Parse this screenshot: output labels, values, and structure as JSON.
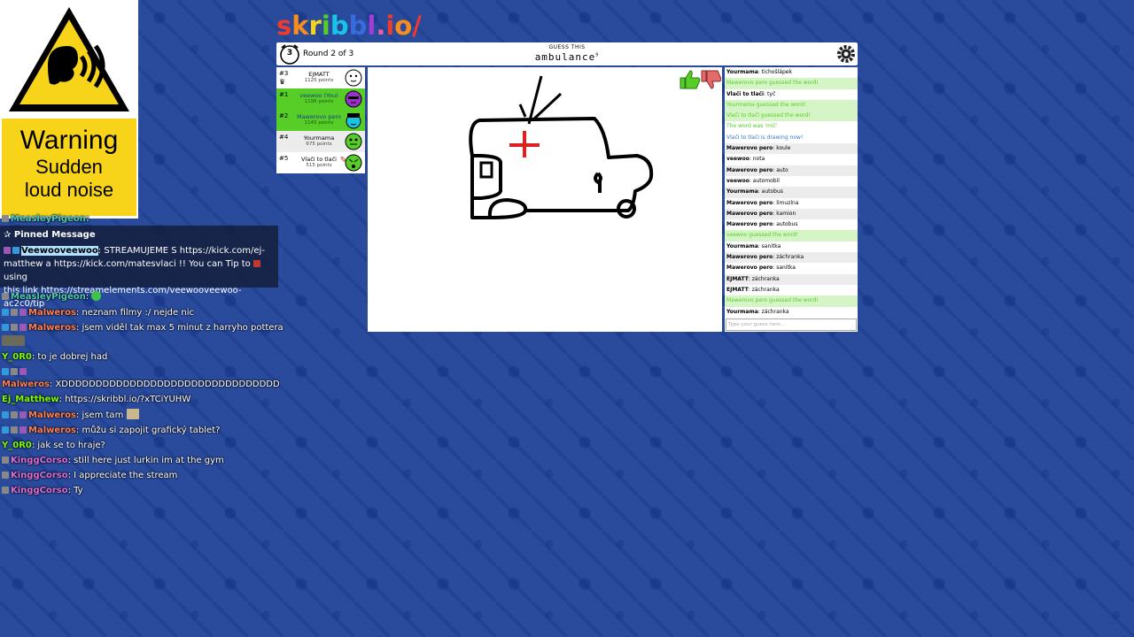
{
  "warning": {
    "title": "Warning",
    "line1": "Sudden",
    "line2": "loud noise"
  },
  "stream_chat": {
    "top_user": "MeasleyPigeon:",
    "pinned_title": "Pinned Message",
    "pinned_user": "Veewooveewoo",
    "pinned_text_1": ": STREAMUJEME S https://kick.com/ej-",
    "pinned_text_2": "matthew a https://kick.com/matesvlaci !! You can Tip to",
    "pinned_text_2b": "using",
    "pinned_text_3": "this link https://streamelements.com/veewooveewoo-ac2c0/tip",
    "messages": [
      {
        "user": "MeasleyPigeon",
        "text": ":",
        "color": "#4ec9b0"
      },
      {
        "user": "Malweros",
        "text": ": neznam filmy :/ nejde nic",
        "color": "#ff7f50"
      },
      {
        "user": "Malweros",
        "text": ": jsem viděl tak max 5 minut z harryho pottera",
        "color": "#ff7f50"
      },
      {
        "user": "Y_0R0",
        "text": ": to je dobrej had",
        "color": "#7cfc00"
      },
      {
        "user": "Malweros",
        "text": ": XDDDDDDDDDDDDDDDDDDDDDDDDDDDDDDDDDDDDD",
        "color": "#ff7f50"
      },
      {
        "user": "Ej_Matthew",
        "text": ": https://skribbl.io/?xTCiYUHW",
        "color": "#7cfc00"
      },
      {
        "user": "Malweros",
        "text": ": jsem tam",
        "color": "#ff7f50"
      },
      {
        "user": "Malweros",
        "text": ": můžu si zapojit grafický tablet?",
        "color": "#ff7f50"
      },
      {
        "user": "Y_0R0",
        "text": ": jak se to hraje?",
        "color": "#7cfc00"
      },
      {
        "user": "KinggCorso",
        "text": ": still here just lurkin im at the gym",
        "color": "#da70d6"
      },
      {
        "user": "KinggCorso",
        "text": ": I appreciate the stream",
        "color": "#da70d6"
      },
      {
        "user": "KinggCorso",
        "text": ": Ty",
        "color": "#da70d6"
      }
    ]
  },
  "game": {
    "logo": "skribbl.io",
    "round_number": "3",
    "round_text": "Round 2 of 3",
    "guess_label": "GUESS THIS",
    "word": "ambulance",
    "word_length": "9",
    "players": [
      {
        "rank": "#3",
        "name": "EJMATT",
        "points": "1125 points",
        "style": "white"
      },
      {
        "rank": "#1",
        "name": "veewoo (You)",
        "points": "1196 points",
        "style": "green"
      },
      {
        "rank": "#2",
        "name": "Mawerovo pero",
        "points": "1145 points",
        "style": "green"
      },
      {
        "rank": "#4",
        "name": "Yourmama",
        "points": "675 points",
        "style": "grey"
      },
      {
        "rank": "#5",
        "name": "Vlači to tlači",
        "points": "515 points",
        "style": "white"
      }
    ],
    "chat": [
      {
        "who": "Yourmama",
        "text": ": tichošlápek",
        "type": "normal"
      },
      {
        "who": "",
        "text": "Mawerovo pero guessed the word!",
        "type": "correct"
      },
      {
        "who": "Vlači to tlači",
        "text": ": tyč",
        "type": "normal"
      },
      {
        "who": "",
        "text": "Yourmama guessed the word!",
        "type": "correct"
      },
      {
        "who": "",
        "text": "Vlači to tlači guessed the word!",
        "type": "correct"
      },
      {
        "who": "",
        "text": "The word was 'míč'",
        "type": "correct"
      },
      {
        "who": "",
        "text": "Vlači to tlači is drawing now!",
        "type": "drawing"
      },
      {
        "who": "Mawerovo pero",
        "text": ": koule",
        "type": "alt"
      },
      {
        "who": "veewoo",
        "text": ": nota",
        "type": "normal"
      },
      {
        "who": "Mawerovo pero",
        "text": ": auto",
        "type": "alt"
      },
      {
        "who": "veewoo",
        "text": ": automobil",
        "type": "normal"
      },
      {
        "who": "Yourmama",
        "text": ": autobus",
        "type": "alt"
      },
      {
        "who": "Mawerovo pero",
        "text": ": limuzína",
        "type": "normal"
      },
      {
        "who": "Mawerovo pero",
        "text": ": kamion",
        "type": "alt"
      },
      {
        "who": "Mawerovo pero",
        "text": ": autobus",
        "type": "normal"
      },
      {
        "who": "",
        "text": "veewoo guessed the word!",
        "type": "correct"
      },
      {
        "who": "Yourmama",
        "text": ": sanitka",
        "type": "normal"
      },
      {
        "who": "Mawerovo pero",
        "text": ": záchranka",
        "type": "alt"
      },
      {
        "who": "Mawerovo pero",
        "text": ": sanitka",
        "type": "normal"
      },
      {
        "who": "EJMATT",
        "text": ": záchranka",
        "type": "alt"
      },
      {
        "who": "EJMATT",
        "text": ": záchranka",
        "type": "normal"
      },
      {
        "who": "",
        "text": "Mawerovo pero guessed the word!",
        "type": "correct"
      },
      {
        "who": "Yourmama",
        "text": ": záchranka",
        "type": "normal"
      }
    ],
    "input_placeholder": "Type your guess here..."
  }
}
